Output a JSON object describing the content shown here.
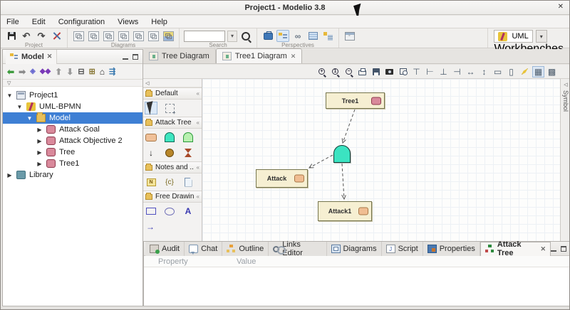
{
  "window": {
    "title": "Project1 - Modelio 3.8",
    "close_glyph": "✕"
  },
  "menu": {
    "items": [
      "File",
      "Edit",
      "Configuration",
      "Views",
      "Help"
    ]
  },
  "toolbar": {
    "project": {
      "label": "Project",
      "icons": [
        "save-icon",
        "undo-icon",
        "redo-icon",
        "tools-icon"
      ]
    },
    "diagrams": {
      "label": "Diagrams",
      "icons": [
        "class-diagram-icon",
        "activity-diagram-icon",
        "usecase-diagram-icon",
        "composite-diagram-icon",
        "actor-diagram-icon",
        "deployment-diagram-icon",
        "matrix-icon"
      ]
    },
    "search": {
      "label": "Search",
      "value": "",
      "icons": [
        "dropdown-icon",
        "magnifier-icon"
      ]
    },
    "perspectives": {
      "label": "Perspectives",
      "icons": [
        "workspace-icon",
        "model-tree-icon",
        "links-icon",
        "table-icon",
        "tree-grid-icon"
      ]
    },
    "window_options_icon": "window-options-icon",
    "workbenches": {
      "label": "Workbenches",
      "selected": "UML",
      "dropdown_glyph": "▾"
    }
  },
  "model_panel": {
    "tab_label": "Model",
    "close_glyph": "✕",
    "toolbar_icons": [
      "back-icon",
      "forward-icon",
      "related-icon",
      "related-all-icon",
      "move-up-icon",
      "move-down-icon",
      "collapse-all-icon",
      "tree-icon",
      "home-icon",
      "configure-icon"
    ],
    "tree": [
      {
        "label": "Project1"
      },
      {
        "label": "UML-BPMN"
      },
      {
        "label": "Model"
      },
      {
        "label": "Attack Goal"
      },
      {
        "label": "Attack Objective 2"
      },
      {
        "label": "Tree"
      },
      {
        "label": "Tree1"
      },
      {
        "label": "Library"
      }
    ]
  },
  "editor": {
    "tabs": [
      {
        "label": "Tree Diagram"
      },
      {
        "label": "Tree1 Diagram",
        "close_glyph": "✕"
      }
    ],
    "diagram_toolbar_icons": [
      "zoom-in-icon",
      "zoom-actual-icon",
      "zoom-out-icon",
      "print-icon",
      "save-diagram-icon",
      "snapshot-icon",
      "fit-to-window-icon",
      "align-top-icon",
      "align-left-icon",
      "align-bottom-icon",
      "align-right-icon",
      "distribute-horizontal-icon",
      "distribute-vertical-icon",
      "same-width-icon",
      "same-height-icon",
      "format-icon",
      "grid-icon",
      "snap-icon"
    ],
    "symbol_tab": "Symbol"
  },
  "palette": {
    "sections": [
      {
        "title": "Default",
        "chevron": "«",
        "items": [
          "select-tool",
          "marquee-tool"
        ]
      },
      {
        "title": "Attack Tree",
        "chevron": "«",
        "items": [
          "attack-node-tool",
          "and-gate-tool",
          "or-gate-tool",
          "connector-tool",
          "counter-node-tool",
          "transfer-node-tool"
        ]
      },
      {
        "title": "Notes and ...",
        "chevron": "«",
        "items": [
          "note-tool",
          "constraint-tool",
          "document-tool"
        ]
      },
      {
        "title": "Free Drawing",
        "chevron": "«",
        "items": [
          "rectangle-tool",
          "ellipse-tool",
          "text-tool",
          "line-tool"
        ]
      }
    ],
    "constraint_glyph": "{c}",
    "text_glyph": "A",
    "line_glyph": "→",
    "connector_glyph": "↓"
  },
  "diagram": {
    "nodes": [
      {
        "label": "Tree1",
        "badge": "pink"
      },
      {
        "label": "Attack",
        "badge": "orange"
      },
      {
        "label": "Attack1",
        "badge": "orange"
      }
    ],
    "gate": "and-gate"
  },
  "bottom_panel": {
    "tabs": [
      {
        "label": "Audit"
      },
      {
        "label": "Chat"
      },
      {
        "label": "Outline"
      },
      {
        "label": "Links Editor"
      },
      {
        "label": "Diagrams"
      },
      {
        "label": "Script"
      },
      {
        "label": "Properties"
      },
      {
        "label": "Attack Tree",
        "close_glyph": "✕"
      }
    ],
    "active_tab": "Attack Tree",
    "table": {
      "columns": [
        "Property",
        "Value"
      ]
    }
  },
  "colors": {
    "selection_blue": "#3e7fd4",
    "node_fill": "#f6efd2",
    "node_border": "#76764e",
    "gate_fill": "#3be3c1",
    "badge_pink": "#d9899b",
    "badge_orange": "#f0bd92"
  }
}
